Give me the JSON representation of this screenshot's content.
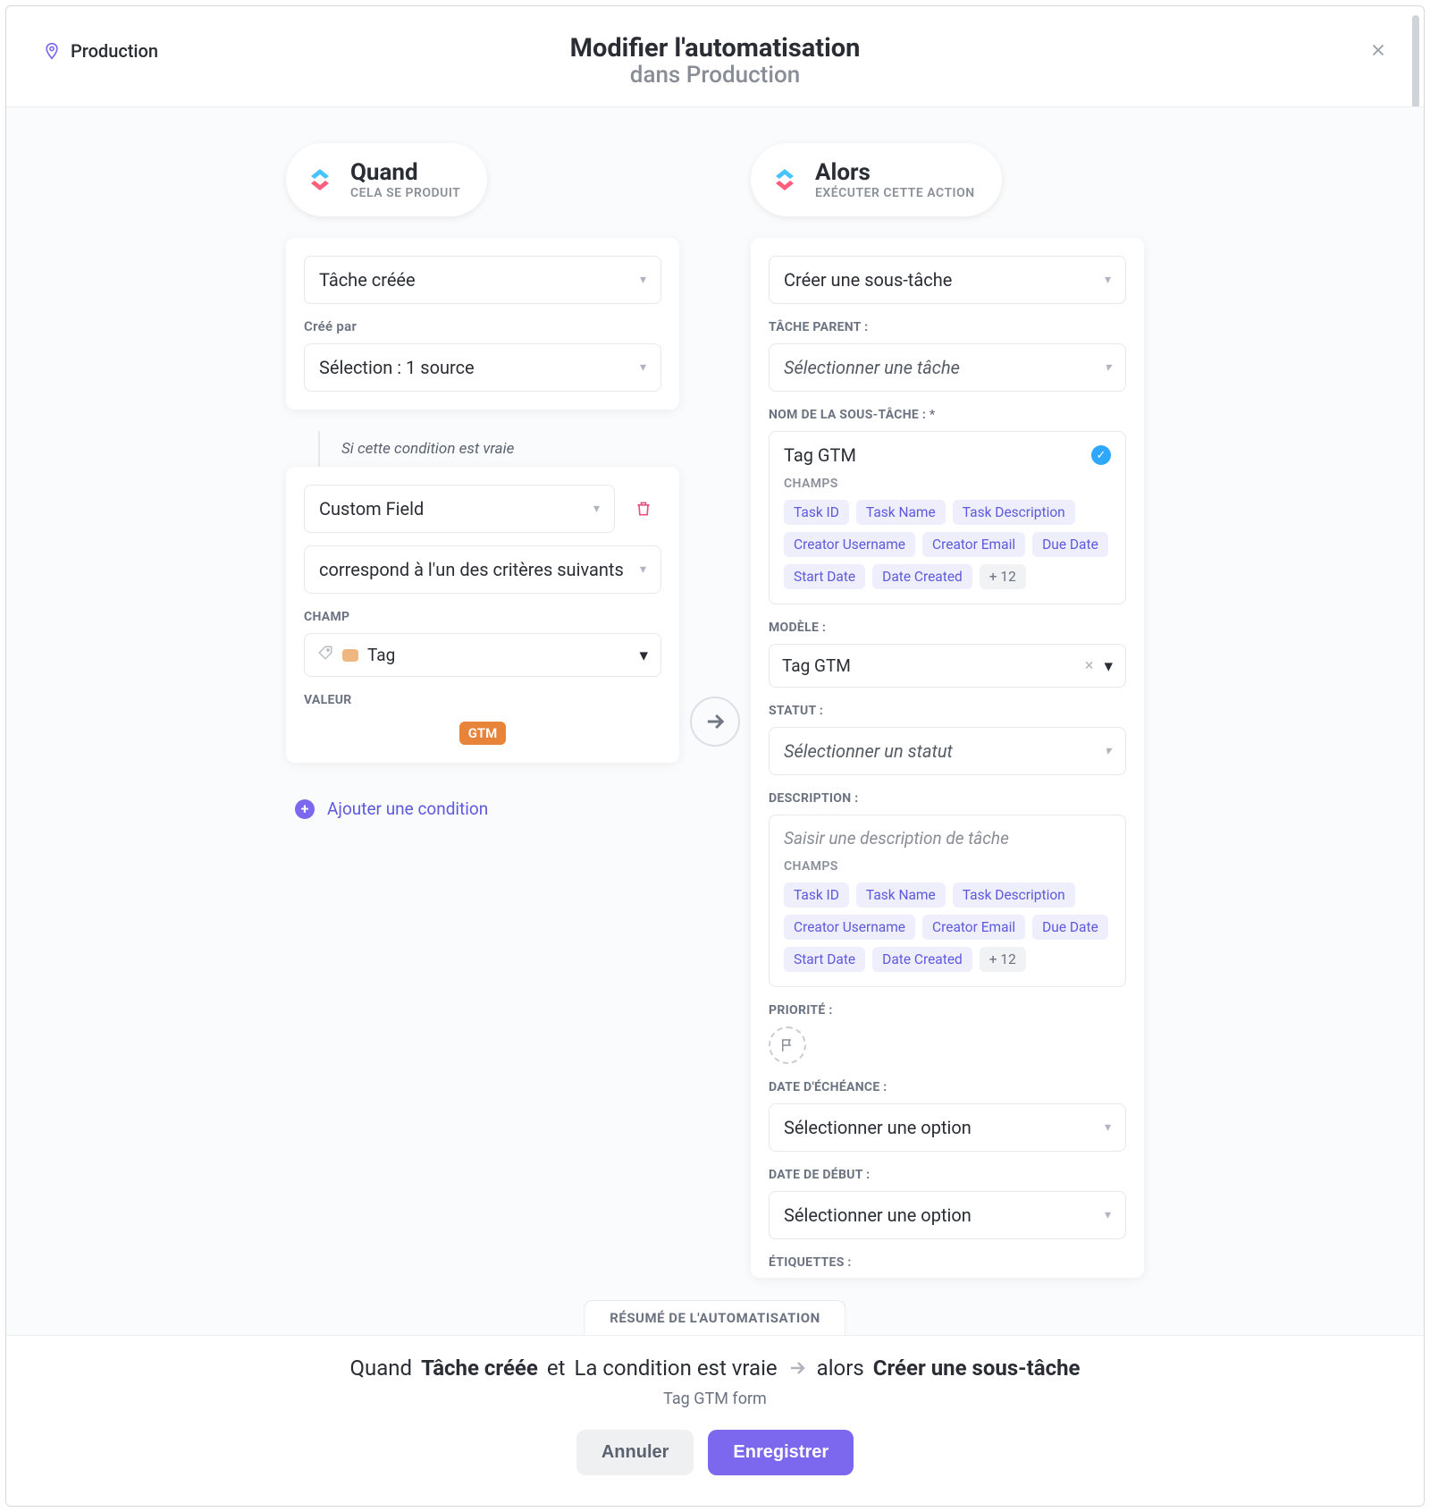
{
  "breadcrumb": {
    "location": "Production"
  },
  "header": {
    "title": "Modifier l'automatisation",
    "subtitle": "dans Production"
  },
  "when": {
    "pill_title": "Quand",
    "pill_sub": "CELA SE PRODUIT",
    "trigger": "Tâche créée",
    "created_by_label": "Créé par",
    "created_by_value": "Sélection : 1 source",
    "connector_text": "Si cette condition est vraie",
    "cond_field": "Custom Field",
    "cond_op": "correspond à l'un des critères suivants",
    "champ_label": "CHAMP",
    "champ_value": "Tag",
    "valeur_label": "VALEUR",
    "valeur_pill": "GTM",
    "add_condition": "Ajouter une condition"
  },
  "then": {
    "pill_title": "Alors",
    "pill_sub": "EXÉCUTER CETTE ACTION",
    "action": "Créer une sous-tâche",
    "parent_label": "TÂCHE PARENT :",
    "parent_value": "Sélectionner une tâche",
    "subtask_name_label": "NOM DE LA SOUS-TÂCHE : *",
    "subtask_name_value": "Tag GTM",
    "champs_label": "CHAMPS",
    "chips": [
      "Task ID",
      "Task Name",
      "Task Description",
      "Creator Username",
      "Creator Email",
      "Due Date",
      "Start Date",
      "Date Created"
    ],
    "chips_more": "+ 12",
    "model_label": "MODÈLE :",
    "model_value": "Tag GTM",
    "status_label": "STATUT :",
    "status_value": "Sélectionner un statut",
    "desc_label": "DESCRIPTION :",
    "desc_placeholder": "Saisir une description de tâche",
    "chips2": [
      "Task ID",
      "Task Name",
      "Task Description",
      "Creator Username",
      "Creator Email",
      "Due Date",
      "Start Date",
      "Date Created"
    ],
    "chips2_more": "+ 12",
    "priority_label": "PRIORITÉ :",
    "due_label": "DATE D'ÉCHÉANCE :",
    "due_value": "Sélectionner une option",
    "start_label": "DATE DE DÉBUT :",
    "start_value": "Sélectionner une option",
    "tags_label": "ÉTIQUETTES :"
  },
  "summary": {
    "tab": "RÉSUMÉ DE L'AUTOMATISATION",
    "when_prefix": "Quand",
    "when_bold": "Tâche créée",
    "cond_conj": "et",
    "cond_text": "La condition est vraie",
    "then_prefix": "alors",
    "then_bold": "Créer une sous-tâche",
    "form_name": "Tag GTM form"
  },
  "buttons": {
    "cancel": "Annuler",
    "save": "Enregistrer"
  }
}
